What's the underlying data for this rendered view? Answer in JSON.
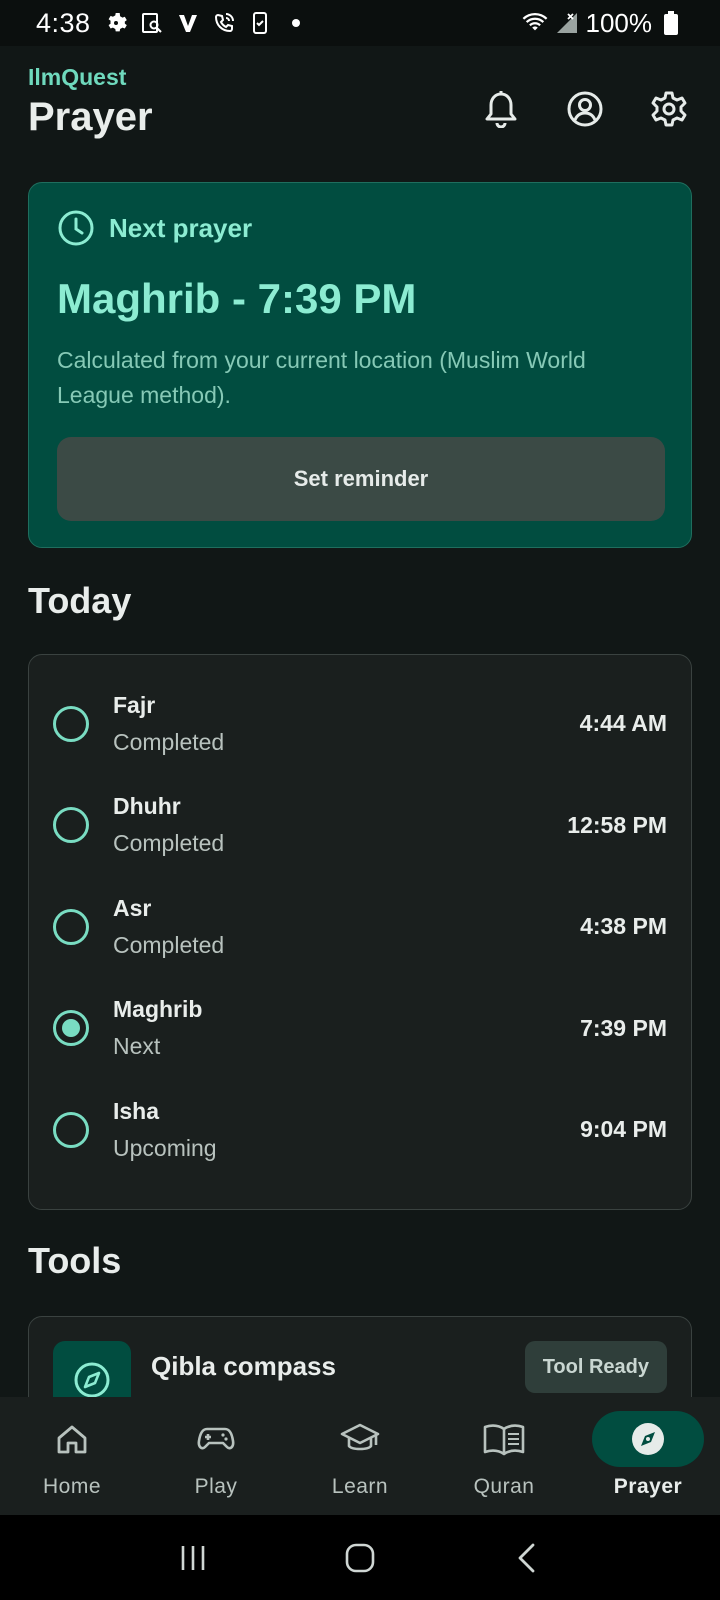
{
  "status_bar": {
    "time": "4:38",
    "battery": "100%"
  },
  "header": {
    "app_name": "IlmQuest",
    "title": "Prayer",
    "icons": [
      "bell-icon",
      "account-icon",
      "settings-icon"
    ]
  },
  "next_prayer": {
    "label": "Next prayer",
    "value": "Maghrib - 7:39 PM",
    "description": "Calculated from your current location (Muslim World League method).",
    "button": "Set reminder"
  },
  "today": {
    "title": "Today",
    "prayers": [
      {
        "name": "Fajr",
        "status": "Completed",
        "time": "4:44 AM",
        "selected": false
      },
      {
        "name": "Dhuhr",
        "status": "Completed",
        "time": "12:58 PM",
        "selected": false
      },
      {
        "name": "Asr",
        "status": "Completed",
        "time": "4:38 PM",
        "selected": false
      },
      {
        "name": "Maghrib",
        "status": "Next",
        "time": "7:39 PM",
        "selected": true
      },
      {
        "name": "Isha",
        "status": "Upcoming",
        "time": "9:04 PM",
        "selected": false
      }
    ]
  },
  "tools": {
    "title": "Tools",
    "items": [
      {
        "name": "Qibla compass",
        "badge": "Tool Ready",
        "icon": "compass-icon"
      }
    ]
  },
  "bottom_nav": {
    "items": [
      {
        "label": "Home",
        "icon": "home-icon"
      },
      {
        "label": "Play",
        "icon": "gamepad-icon"
      },
      {
        "label": "Learn",
        "icon": "graduation-cap-icon"
      },
      {
        "label": "Quran",
        "icon": "book-icon"
      },
      {
        "label": "Prayer",
        "icon": "compass-icon",
        "active": true
      }
    ]
  },
  "colors": {
    "accent": "#6fd9bd",
    "card_green": "#014d40",
    "background": "#111716"
  }
}
